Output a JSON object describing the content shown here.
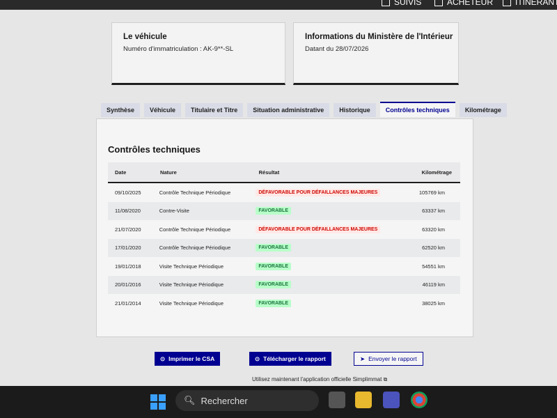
{
  "topnav": {
    "items": [
      "SUIVIS",
      "ACHETEUR",
      "ITINÉRANT"
    ]
  },
  "vehicle_card": {
    "title": "Le véhicule",
    "plate": "Numéro d'immatriculation : AK-9**-SL"
  },
  "ministry_card": {
    "title": "Informations du Ministère de l'Intérieur",
    "date": "Datant du 28/07/2026"
  },
  "tabs": [
    "Synthèse",
    "Véhicule",
    "Titulaire et Titre",
    "Situation administrative",
    "Historique",
    "Contrôles techniques",
    "Kilométrage"
  ],
  "active_tab": "Contrôles techniques",
  "section": {
    "title": "Contrôles techniques",
    "headers": {
      "date": "Date",
      "nature": "Nature",
      "result": "Résultat",
      "km": "Kilométrage"
    },
    "rows": [
      {
        "date": "09/10/2025",
        "nature": "Contrôle Technique Périodique",
        "result": "DÉFAVORABLE POUR DÉFAILLANCES MAJEURES",
        "status": "defavorable",
        "km": "105769 km"
      },
      {
        "date": "11/08/2020",
        "nature": "Contre-Visite",
        "result": "FAVORABLE",
        "status": "favorable",
        "km": "63337 km"
      },
      {
        "date": "21/07/2020",
        "nature": "Contrôle Technique Périodique",
        "result": "DÉFAVORABLE POUR DÉFAILLANCES MAJEURES",
        "status": "defavorable",
        "km": "63320 km"
      },
      {
        "date": "17/01/2020",
        "nature": "Contrôle Technique Périodique",
        "result": "FAVORABLE",
        "status": "favorable",
        "km": "62520 km"
      },
      {
        "date": "19/01/2018",
        "nature": "Visite Technique Périodique",
        "result": "FAVORABLE",
        "status": "favorable",
        "km": "54551 km"
      },
      {
        "date": "20/01/2016",
        "nature": "Visite Technique Périodique",
        "result": "FAVORABLE",
        "status": "favorable",
        "km": "46119 km"
      },
      {
        "date": "21/01/2014",
        "nature": "Visite Technique Périodique",
        "result": "FAVORABLE",
        "status": "favorable",
        "km": "38025 km"
      }
    ]
  },
  "buttons": {
    "print": "Imprimer le CSA",
    "download": "Télécharger le rapport",
    "send": "Envoyer le rapport"
  },
  "footer": {
    "text": "Utilisez maintenant l'application officielle Simplimmat"
  },
  "taskbar": {
    "search_placeholder": "Rechercher"
  },
  "colors": {
    "primary": "#000091",
    "favorable": "#18753c",
    "defavorable": "#ce0500"
  }
}
